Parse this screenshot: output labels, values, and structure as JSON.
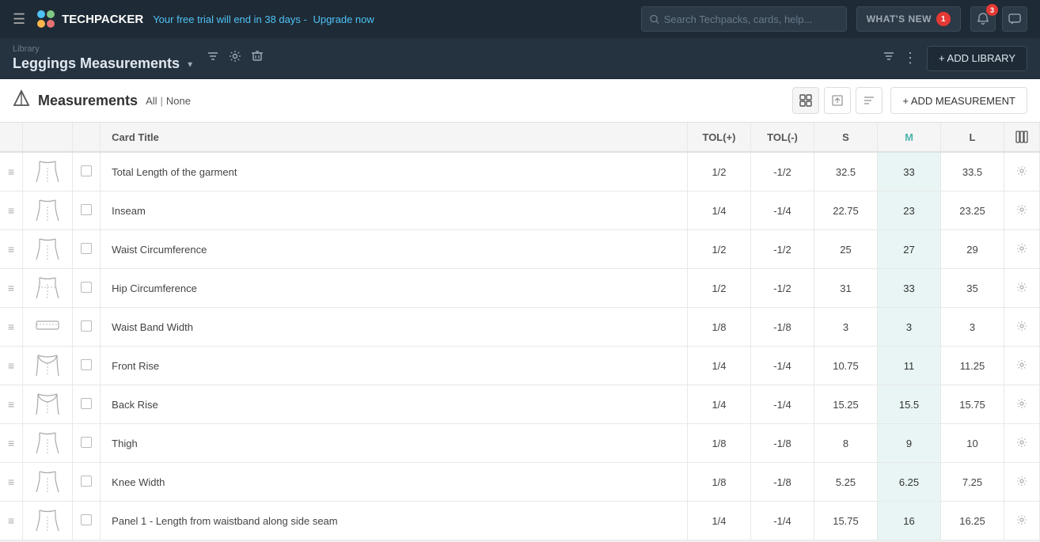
{
  "topnav": {
    "logo_text": "TECHPACKER",
    "trial_text": "Your free trial will end in 38 days -",
    "upgrade_label": "Upgrade now",
    "search_placeholder": "Search Techpacks, cards, help...",
    "whatsnew_label": "WHAT'S NEW",
    "whatsnew_badge": "1",
    "notifications_badge": "3"
  },
  "library_bar": {
    "sublabel": "Library",
    "title": "Leggings Measurements",
    "add_library_label": "+ ADD LIBRARY"
  },
  "measurements_section": {
    "title": "Measurements",
    "filter_all": "All",
    "filter_sep": "|",
    "filter_none": "None",
    "add_measurement_label": "+ ADD MEASUREMENT"
  },
  "table": {
    "columns": [
      "",
      "",
      "",
      "Card Title",
      "TOL(+)",
      "TOL(-)",
      "S",
      "M",
      "L",
      ""
    ],
    "rows": [
      {
        "title": "Total Length of the garment",
        "tol_plus": "1/2",
        "tol_minus": "-1/2",
        "s": "32.5",
        "m": "33",
        "l": "33.5",
        "sketch": "leggings_front"
      },
      {
        "title": "Inseam",
        "tol_plus": "1/4",
        "tol_minus": "-1/4",
        "s": "22.75",
        "m": "23",
        "l": "23.25",
        "sketch": "leggings_front"
      },
      {
        "title": "Waist Circumference",
        "tol_plus": "1/2",
        "tol_minus": "-1/2",
        "s": "25",
        "m": "27",
        "l": "29",
        "sketch": "leggings_waist"
      },
      {
        "title": "Hip Circumference",
        "tol_plus": "1/2",
        "tol_minus": "-1/2",
        "s": "31",
        "m": "33",
        "l": "35",
        "sketch": "leggings_hip"
      },
      {
        "title": "Waist Band Width",
        "tol_plus": "1/8",
        "tol_minus": "-1/8",
        "s": "3",
        "m": "3",
        "l": "3",
        "sketch": "waistband"
      },
      {
        "title": "Front Rise",
        "tol_plus": "1/4",
        "tol_minus": "-1/4",
        "s": "10.75",
        "m": "11",
        "l": "11.25",
        "sketch": "front_rise"
      },
      {
        "title": "Back Rise",
        "tol_plus": "1/4",
        "tol_minus": "-1/4",
        "s": "15.25",
        "m": "15.5",
        "l": "15.75",
        "sketch": "back_rise"
      },
      {
        "title": "Thigh",
        "tol_plus": "1/8",
        "tol_minus": "-1/8",
        "s": "8",
        "m": "9",
        "l": "10",
        "sketch": "leggings_front"
      },
      {
        "title": "Knee Width",
        "tol_plus": "1/8",
        "tol_minus": "-1/8",
        "s": "5.25",
        "m": "6.25",
        "l": "7.25",
        "sketch": "leggings_front"
      },
      {
        "title": "Panel 1 - Length from waistband along side seam",
        "tol_plus": "1/4",
        "tol_minus": "-1/4",
        "s": "15.75",
        "m": "16",
        "l": "16.25",
        "sketch": "leggings_front"
      }
    ]
  }
}
